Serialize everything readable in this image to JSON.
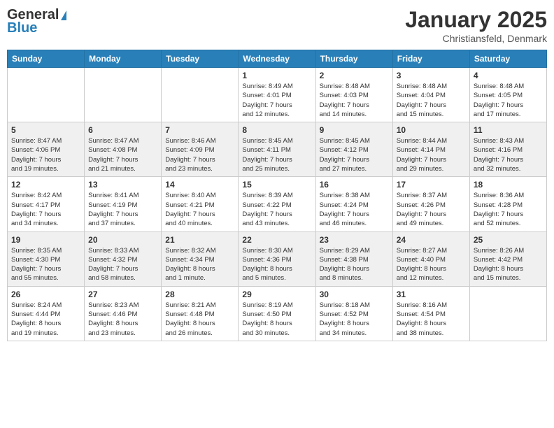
{
  "logo": {
    "general": "General",
    "blue": "Blue"
  },
  "header": {
    "title": "January 2025",
    "subtitle": "Christiansfeld, Denmark"
  },
  "weekdays": [
    "Sunday",
    "Monday",
    "Tuesday",
    "Wednesday",
    "Thursday",
    "Friday",
    "Saturday"
  ],
  "weeks": [
    [
      {
        "day": "",
        "info": ""
      },
      {
        "day": "",
        "info": ""
      },
      {
        "day": "",
        "info": ""
      },
      {
        "day": "1",
        "info": "Sunrise: 8:49 AM\nSunset: 4:01 PM\nDaylight: 7 hours\nand 12 minutes."
      },
      {
        "day": "2",
        "info": "Sunrise: 8:48 AM\nSunset: 4:03 PM\nDaylight: 7 hours\nand 14 minutes."
      },
      {
        "day": "3",
        "info": "Sunrise: 8:48 AM\nSunset: 4:04 PM\nDaylight: 7 hours\nand 15 minutes."
      },
      {
        "day": "4",
        "info": "Sunrise: 8:48 AM\nSunset: 4:05 PM\nDaylight: 7 hours\nand 17 minutes."
      }
    ],
    [
      {
        "day": "5",
        "info": "Sunrise: 8:47 AM\nSunset: 4:06 PM\nDaylight: 7 hours\nand 19 minutes."
      },
      {
        "day": "6",
        "info": "Sunrise: 8:47 AM\nSunset: 4:08 PM\nDaylight: 7 hours\nand 21 minutes."
      },
      {
        "day": "7",
        "info": "Sunrise: 8:46 AM\nSunset: 4:09 PM\nDaylight: 7 hours\nand 23 minutes."
      },
      {
        "day": "8",
        "info": "Sunrise: 8:45 AM\nSunset: 4:11 PM\nDaylight: 7 hours\nand 25 minutes."
      },
      {
        "day": "9",
        "info": "Sunrise: 8:45 AM\nSunset: 4:12 PM\nDaylight: 7 hours\nand 27 minutes."
      },
      {
        "day": "10",
        "info": "Sunrise: 8:44 AM\nSunset: 4:14 PM\nDaylight: 7 hours\nand 29 minutes."
      },
      {
        "day": "11",
        "info": "Sunrise: 8:43 AM\nSunset: 4:16 PM\nDaylight: 7 hours\nand 32 minutes."
      }
    ],
    [
      {
        "day": "12",
        "info": "Sunrise: 8:42 AM\nSunset: 4:17 PM\nDaylight: 7 hours\nand 34 minutes."
      },
      {
        "day": "13",
        "info": "Sunrise: 8:41 AM\nSunset: 4:19 PM\nDaylight: 7 hours\nand 37 minutes."
      },
      {
        "day": "14",
        "info": "Sunrise: 8:40 AM\nSunset: 4:21 PM\nDaylight: 7 hours\nand 40 minutes."
      },
      {
        "day": "15",
        "info": "Sunrise: 8:39 AM\nSunset: 4:22 PM\nDaylight: 7 hours\nand 43 minutes."
      },
      {
        "day": "16",
        "info": "Sunrise: 8:38 AM\nSunset: 4:24 PM\nDaylight: 7 hours\nand 46 minutes."
      },
      {
        "day": "17",
        "info": "Sunrise: 8:37 AM\nSunset: 4:26 PM\nDaylight: 7 hours\nand 49 minutes."
      },
      {
        "day": "18",
        "info": "Sunrise: 8:36 AM\nSunset: 4:28 PM\nDaylight: 7 hours\nand 52 minutes."
      }
    ],
    [
      {
        "day": "19",
        "info": "Sunrise: 8:35 AM\nSunset: 4:30 PM\nDaylight: 7 hours\nand 55 minutes."
      },
      {
        "day": "20",
        "info": "Sunrise: 8:33 AM\nSunset: 4:32 PM\nDaylight: 7 hours\nand 58 minutes."
      },
      {
        "day": "21",
        "info": "Sunrise: 8:32 AM\nSunset: 4:34 PM\nDaylight: 8 hours\nand 1 minute."
      },
      {
        "day": "22",
        "info": "Sunrise: 8:30 AM\nSunset: 4:36 PM\nDaylight: 8 hours\nand 5 minutes."
      },
      {
        "day": "23",
        "info": "Sunrise: 8:29 AM\nSunset: 4:38 PM\nDaylight: 8 hours\nand 8 minutes."
      },
      {
        "day": "24",
        "info": "Sunrise: 8:27 AM\nSunset: 4:40 PM\nDaylight: 8 hours\nand 12 minutes."
      },
      {
        "day": "25",
        "info": "Sunrise: 8:26 AM\nSunset: 4:42 PM\nDaylight: 8 hours\nand 15 minutes."
      }
    ],
    [
      {
        "day": "26",
        "info": "Sunrise: 8:24 AM\nSunset: 4:44 PM\nDaylight: 8 hours\nand 19 minutes."
      },
      {
        "day": "27",
        "info": "Sunrise: 8:23 AM\nSunset: 4:46 PM\nDaylight: 8 hours\nand 23 minutes."
      },
      {
        "day": "28",
        "info": "Sunrise: 8:21 AM\nSunset: 4:48 PM\nDaylight: 8 hours\nand 26 minutes."
      },
      {
        "day": "29",
        "info": "Sunrise: 8:19 AM\nSunset: 4:50 PM\nDaylight: 8 hours\nand 30 minutes."
      },
      {
        "day": "30",
        "info": "Sunrise: 8:18 AM\nSunset: 4:52 PM\nDaylight: 8 hours\nand 34 minutes."
      },
      {
        "day": "31",
        "info": "Sunrise: 8:16 AM\nSunset: 4:54 PM\nDaylight: 8 hours\nand 38 minutes."
      },
      {
        "day": "",
        "info": ""
      }
    ]
  ]
}
